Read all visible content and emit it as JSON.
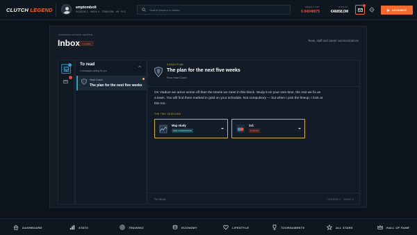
{
  "app": {
    "logo_main": "CLUTCH",
    "logo_accent": "LEGEND"
  },
  "header": {
    "username": "emptombolt",
    "season_info": "SEASON 2 · WEEK 6 · TEAM RIN · #5 · PLS",
    "search_placeholder": "Search players or teams",
    "weekly_net_label": "WEEKLY NET",
    "weekly_net_value": "€-94048075",
    "budget_label": "BUDGET",
    "budget_value": "€46858.0M",
    "advance_label": "ADVANCE",
    "colors": {
      "accent": "#f26a2e",
      "negative": "#e8524b",
      "gold": "#e0b63b"
    }
  },
  "page": {
    "overline": "COMMUNICATIONS CENTRE",
    "title": "Inbox",
    "unread_chip": "1 unread",
    "subtitle": "Team, staff and career communications"
  },
  "list": {
    "heading": "To read",
    "subheading": "1 messages waiting for you",
    "items": [
      {
        "from": "Head Coach",
        "subject": "The plan for the next five weeks"
      }
    ]
  },
  "message": {
    "tag": "COACH PLAN",
    "title": "The plan for the next five weeks",
    "from": "From Head Coach",
    "body": "On Viaduct we arrive worse off than the teams we meet in this block. Study it on your own time, the rest we fix as a team. You will find them marked in gold on your schedule. Not compulsory — but when I pick the lineup, I look at this too.",
    "sessions_title": "THE TWO SESSIONS",
    "sessions": [
      {
        "name": "Map study",
        "chip": "MAP KNOWLEDGE"
      },
      {
        "name": "1v1",
        "chip": "CLUTCH"
      }
    ],
    "footer_left": "TO READ",
    "footer_right": "SEASON 2 · WEEK 6"
  },
  "nav": {
    "items": [
      {
        "label": "DASHBOARD",
        "icon": "home-icon"
      },
      {
        "label": "STATS",
        "icon": "bars-icon"
      },
      {
        "label": "TRAINING",
        "icon": "target-icon"
      },
      {
        "label": "ECONOMY",
        "icon": "coins-icon"
      },
      {
        "label": "LIFESTYLE",
        "icon": "heart-icon"
      },
      {
        "label": "TOURNAMENTS",
        "icon": "trophy-icon"
      },
      {
        "label": "ALL STARS",
        "icon": "star-icon"
      },
      {
        "label": "HALL OF FAME",
        "icon": "crown-icon"
      }
    ]
  }
}
